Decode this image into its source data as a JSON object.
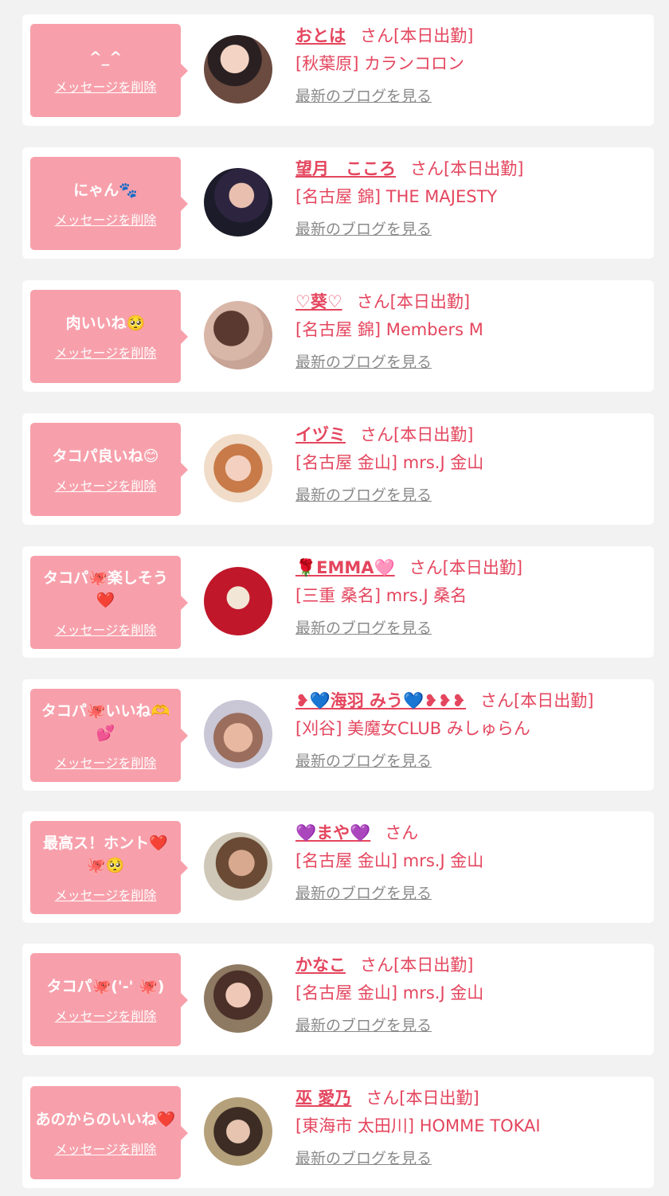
{
  "delete_label": "メッセージを削除",
  "blog_label": "最新のブログを見る",
  "colors": {
    "background": "#f2f2f2",
    "bubble": "#f7a0ab",
    "accent": "#e4465e",
    "link_gray": "#8a8a8a"
  },
  "items": [
    {
      "message": "^_^",
      "name": "おとは",
      "suffix": "さん[本日出勤]",
      "shop": "[秋葉原] カランコロン"
    },
    {
      "message": "にゃん🐾",
      "name": "望月　こころ",
      "suffix": "さん[本日出勤]",
      "shop": "[名古屋 錦] THE MAJESTY"
    },
    {
      "message": "肉いいね🥺",
      "name": "♡葵♡",
      "suffix": "さん[本日出勤]",
      "shop": "[名古屋 錦] Members M"
    },
    {
      "message": "タコパ良いね😊",
      "name": "イヅミ",
      "suffix": "さん[本日出勤]",
      "shop": "[名古屋 金山] mrs.J 金山"
    },
    {
      "message": "タコパ🐙楽しそう❤️",
      "name": "🌹EMMA🩷",
      "suffix": "さん[本日出勤]",
      "shop": "[三重 桑名] mrs.J 桑名"
    },
    {
      "message": "タコパ🐙いいね🫶💕",
      "name": "❥💙海羽 みう💙❥❥❥",
      "suffix": "さん[本日出勤]",
      "shop": "[刈谷] 美魔女CLUB みしゅらん"
    },
    {
      "message": "最高ス！ホント❤️🐙🥺",
      "name": "💜まや💜",
      "suffix": "さん",
      "shop": "[名古屋 金山] mrs.J 金山"
    },
    {
      "message": "タコパ🐙('-' 🐙)",
      "name": "かなこ",
      "suffix": "さん[本日出勤]",
      "shop": "[名古屋 金山] mrs.J 金山"
    },
    {
      "message": "あのからのいいね❤️",
      "name": "巫 愛乃",
      "suffix": "さん[本日出勤]",
      "shop": "[東海市 太田川] HOMME TOKAI"
    }
  ]
}
